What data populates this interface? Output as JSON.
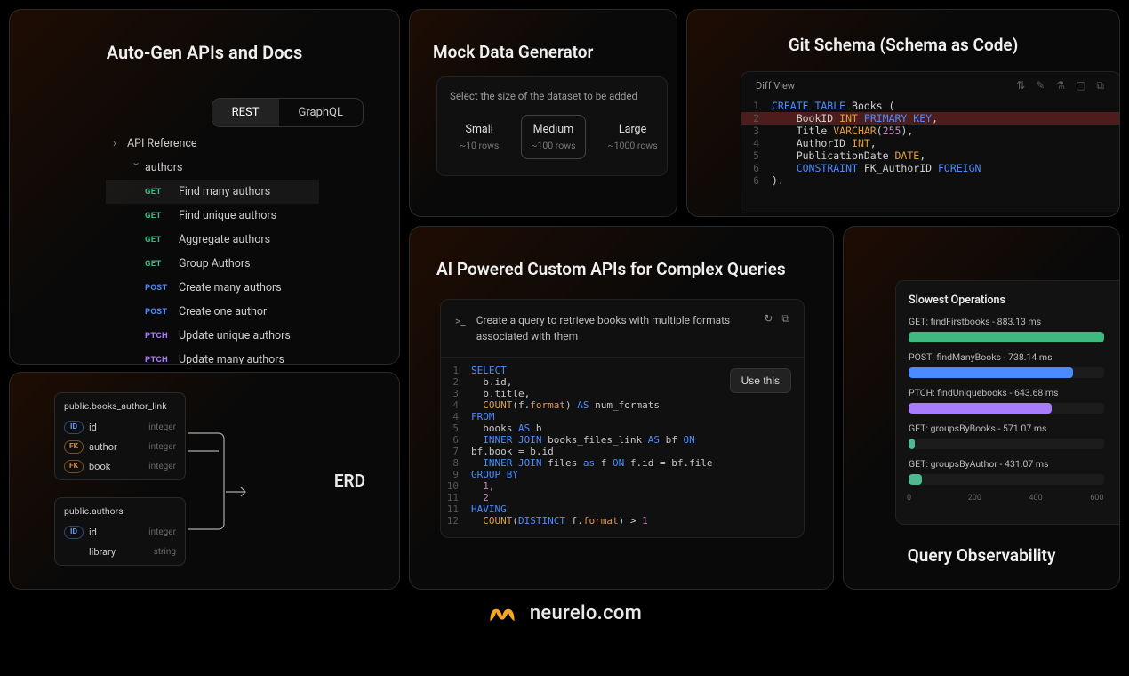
{
  "card1": {
    "title": "Auto-Gen APIs and Docs",
    "tabs": {
      "rest": "REST",
      "graphql": "GraphQL"
    },
    "root": "API Reference",
    "group": "authors",
    "endpoints": [
      {
        "method": "GET",
        "label": "Find many authors"
      },
      {
        "method": "GET",
        "label": "Find unique authors"
      },
      {
        "method": "GET",
        "label": "Aggregate authors"
      },
      {
        "method": "GET",
        "label": "Group Authors"
      },
      {
        "method": "POST",
        "label": "Create many authors"
      },
      {
        "method": "POST",
        "label": "Create one author"
      },
      {
        "method": "PTCH",
        "label": "Update unique authors"
      },
      {
        "method": "PTCH",
        "label": "Update many authors"
      }
    ]
  },
  "card2": {
    "title": "Mock Data Generator",
    "prompt": "Select the size of the dataset to be added",
    "options": [
      {
        "name": "Small",
        "rows": "~10 rows"
      },
      {
        "name": "Medium",
        "rows": "~100 rows"
      },
      {
        "name": "Large",
        "rows": "~1000 rows"
      }
    ]
  },
  "card3": {
    "title": "Git Schema (Schema as Code)",
    "header": "Diff View",
    "code": [
      {
        "n": "1",
        "hi": false,
        "parts": [
          [
            "kw",
            "CREATE TABLE"
          ],
          [
            "nm",
            " Books ("
          ]
        ]
      },
      {
        "n": "2",
        "hi": true,
        "parts": [
          [
            "nm",
            "    BookID "
          ],
          [
            "ty",
            "INT"
          ],
          [
            "nm",
            " "
          ],
          [
            "kw",
            "PRIMARY KEY"
          ],
          [
            "nm",
            ","
          ]
        ]
      },
      {
        "n": "3",
        "hi": false,
        "parts": [
          [
            "nm",
            "    Title "
          ],
          [
            "ty",
            "VARCHAR"
          ],
          [
            "nm",
            "("
          ],
          [
            "num",
            "255"
          ],
          [
            "nm",
            "),"
          ]
        ]
      },
      {
        "n": "4",
        "hi": false,
        "parts": [
          [
            "nm",
            "    AuthorID "
          ],
          [
            "ty",
            "INT"
          ],
          [
            "nm",
            ","
          ]
        ]
      },
      {
        "n": "5",
        "hi": false,
        "parts": [
          [
            "nm",
            "    PublicationDate "
          ],
          [
            "ty",
            "DATE"
          ],
          [
            "nm",
            ","
          ]
        ]
      },
      {
        "n": "6",
        "hi": false,
        "parts": [
          [
            "nm",
            "    "
          ],
          [
            "kw",
            "CONSTRAINT"
          ],
          [
            "nm",
            " FK_AuthorID "
          ],
          [
            "kw",
            "FOREIGN"
          ]
        ]
      },
      {
        "n": "6",
        "hi": false,
        "parts": [
          [
            "nm",
            ")."
          ]
        ]
      }
    ]
  },
  "card4": {
    "title": "ERD",
    "table1": {
      "name": "public.books_author_link",
      "rows": [
        {
          "badge": "ID",
          "col": "id",
          "type": "integer"
        },
        {
          "badge": "FK",
          "col": "author",
          "type": "integer"
        },
        {
          "badge": "FK",
          "col": "book",
          "type": "integer"
        }
      ]
    },
    "table2": {
      "name": "public.authors",
      "rows": [
        {
          "badge": "ID",
          "col": "id",
          "type": "integer"
        },
        {
          "badge": "",
          "col": "library",
          "type": "string"
        }
      ]
    }
  },
  "card5": {
    "title": "AI Powered Custom APIs for Complex Queries",
    "prompt": "Create a query to retrieve books with multiple formats associated with them",
    "use_btn": "Use this",
    "code": [
      {
        "n": "1",
        "parts": [
          [
            "sql-kw",
            "SELECT"
          ]
        ]
      },
      {
        "n": "2",
        "parts": [
          [
            "sql-id",
            "  b.id,"
          ]
        ]
      },
      {
        "n": "3",
        "parts": [
          [
            "sql-id",
            "  b.title,"
          ]
        ]
      },
      {
        "n": "4",
        "parts": [
          [
            "sql-id",
            "  "
          ],
          [
            "sql-fn",
            "COUNT"
          ],
          [
            "sql-id",
            "(f."
          ],
          [
            "sql-str",
            "format"
          ],
          [
            "sql-id",
            ") "
          ],
          [
            "sql-kw",
            "AS"
          ],
          [
            "sql-id",
            " num_formats"
          ]
        ]
      },
      {
        "n": "4",
        "parts": [
          [
            "sql-kw",
            "FROM"
          ]
        ]
      },
      {
        "n": "5",
        "parts": [
          [
            "sql-id",
            "  books "
          ],
          [
            "sql-kw",
            "AS"
          ],
          [
            "sql-id",
            " b"
          ]
        ]
      },
      {
        "n": "6",
        "parts": [
          [
            "sql-id",
            "  "
          ],
          [
            "sql-kw",
            "INNER JOIN"
          ],
          [
            "sql-id",
            " books_files_link "
          ],
          [
            "sql-kw",
            "AS"
          ],
          [
            "sql-id",
            " bf "
          ],
          [
            "sql-kw",
            "ON"
          ]
        ]
      },
      {
        "n": "7",
        "parts": [
          [
            "sql-id",
            "bf.book = b.id"
          ]
        ]
      },
      {
        "n": "8",
        "parts": [
          [
            "sql-id",
            "  "
          ],
          [
            "sql-kw",
            "INNER JOIN"
          ],
          [
            "sql-id",
            " files "
          ],
          [
            "sql-kw",
            "as"
          ],
          [
            "sql-id",
            " f "
          ],
          [
            "sql-kw",
            "ON"
          ],
          [
            "sql-id",
            " f.id = bf.file"
          ]
        ]
      },
      {
        "n": "9",
        "parts": [
          [
            "sql-kw",
            "GROUP BY"
          ]
        ]
      },
      {
        "n": "10",
        "parts": [
          [
            "sql-id",
            "  "
          ],
          [
            "sql-num",
            "1"
          ],
          [
            "sql-id",
            ","
          ]
        ]
      },
      {
        "n": "11",
        "parts": [
          [
            "sql-id",
            "  "
          ],
          [
            "sql-num",
            "2"
          ]
        ]
      },
      {
        "n": "11",
        "parts": [
          [
            "sql-kw",
            "HAVING"
          ]
        ]
      },
      {
        "n": "12",
        "parts": [
          [
            "sql-id",
            "  "
          ],
          [
            "sql-fn",
            "COUNT"
          ],
          [
            "sql-id",
            "("
          ],
          [
            "sql-kw",
            "DISTINCT"
          ],
          [
            "sql-id",
            " f."
          ],
          [
            "sql-str",
            "format"
          ],
          [
            "sql-id",
            ") > "
          ],
          [
            "sql-num",
            "1"
          ]
        ]
      }
    ]
  },
  "card6": {
    "title": "Query Observability",
    "panel_title": "Slowest Operations",
    "ops": [
      {
        "label": "GET: findFirstbooks - 883.13 ms",
        "pct": 100,
        "color": "green"
      },
      {
        "label": "POST: findManyBooks - 738.14 ms",
        "pct": 84,
        "color": "blue"
      },
      {
        "label": "PTCH: findUniquebooks - 643.68 ms",
        "pct": 73,
        "color": "purple"
      },
      {
        "label": "GET: groupsByBooks - 571.07 ms",
        "pct": 3,
        "color": "mint"
      },
      {
        "label": "GET: groupsByAuthor - 431.07 ms",
        "pct": 7,
        "color": "mint2"
      }
    ],
    "axis": [
      "0",
      "200",
      "400",
      "600"
    ]
  },
  "footer": {
    "brand": "neurelo.com"
  }
}
